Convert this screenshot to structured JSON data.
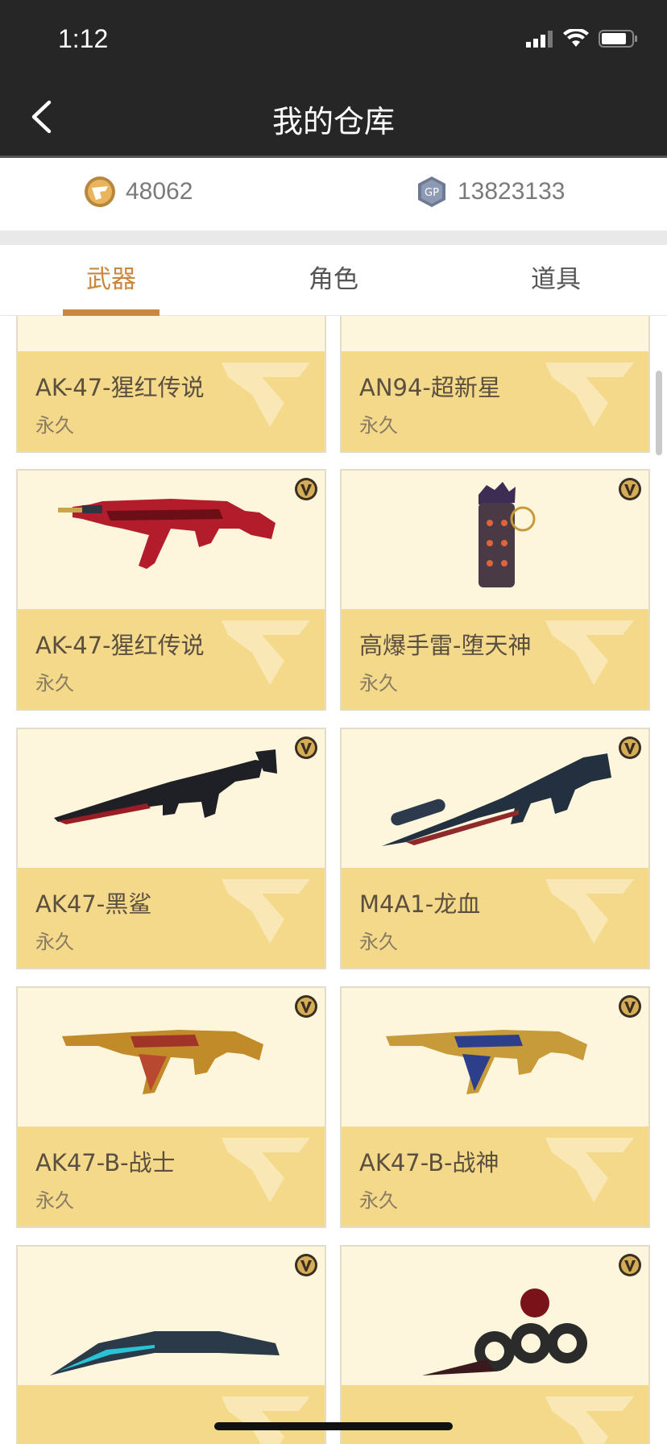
{
  "status": {
    "time": "1:12"
  },
  "header": {
    "title": "我的仓库"
  },
  "currency": {
    "cf_points": "48062",
    "gp_points": "13823133",
    "gp_label": "GP"
  },
  "tabs": [
    {
      "label": "武器",
      "active": true
    },
    {
      "label": "角色",
      "active": false
    },
    {
      "label": "道具",
      "active": false
    }
  ],
  "items": [
    {
      "name": "AK-47-猩红传说",
      "duration": "永久",
      "icon": "rifle-red-icon"
    },
    {
      "name": "AN94-超新星",
      "duration": "永久",
      "icon": "rifle-white-icon"
    },
    {
      "name": "AK-47-猩红传说",
      "duration": "永久",
      "icon": "rifle-red-icon"
    },
    {
      "name": "高爆手雷-堕天神",
      "duration": "永久",
      "icon": "grenade-icon"
    },
    {
      "name": "AK47-黑鲨",
      "duration": "永久",
      "icon": "rifle-black-icon"
    },
    {
      "name": "M4A1-龙血",
      "duration": "永久",
      "icon": "rifle-blue-icon"
    },
    {
      "name": "AK47-B-战士",
      "duration": "永久",
      "icon": "rifle-gold-icon"
    },
    {
      "name": "AK47-B-战神",
      "duration": "永久",
      "icon": "rifle-gold-blue-icon"
    },
    {
      "name": "",
      "duration": "",
      "icon": "blade-icon"
    },
    {
      "name": "",
      "duration": "",
      "icon": "knuckle-icon"
    }
  ],
  "colors": {
    "accent": "#c9883d",
    "card_bottom": "#f4d98a",
    "card_top": "#fdf6dc",
    "header": "#262626"
  }
}
